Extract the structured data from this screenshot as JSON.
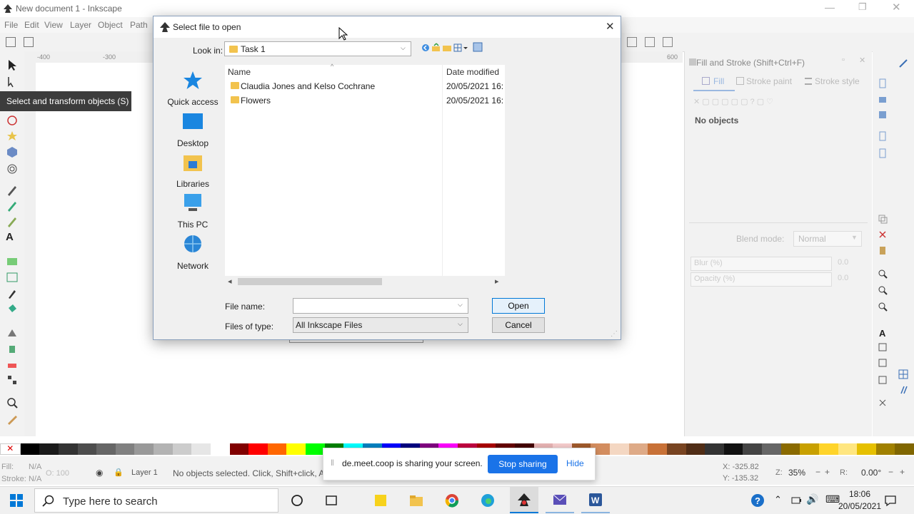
{
  "app": {
    "window_title": "New document 1 - Inkscape",
    "menus": [
      "File",
      "Edit",
      "View",
      "Layer",
      "Object",
      "Path"
    ],
    "tooltip": "Select and transform objects (S)",
    "ruler_marks": [
      "-400",
      "-300",
      "600"
    ]
  },
  "fill_stroke_panel": {
    "title": "Fill and Stroke (Shift+Ctrl+F)",
    "tabs": [
      "Fill",
      "Stroke paint",
      "Stroke style"
    ],
    "no_objects": "No objects",
    "blend_mode_label": "Blend mode:",
    "blend_mode_value": "Normal",
    "blur_label": "Blur (%)",
    "blur_value": "0.0",
    "opacity_label": "Opacity (%)",
    "opacity_value": "0.0"
  },
  "dialog": {
    "title": "Select file to open",
    "look_in_label": "Look in:",
    "look_in_value": "Task 1",
    "nav_items": [
      {
        "label": "Quick access",
        "icon": "star-icon"
      },
      {
        "label": "Desktop",
        "icon": "desktop-icon"
      },
      {
        "label": "Libraries",
        "icon": "libraries-icon"
      },
      {
        "label": "This PC",
        "icon": "computer-icon"
      },
      {
        "label": "Network",
        "icon": "network-icon"
      }
    ],
    "columns": {
      "name": "Name",
      "date": "Date modified"
    },
    "files": [
      {
        "name": "Claudia Jones and Kelso Cochrane",
        "date": "20/05/2021 16:"
      },
      {
        "name": "Flowers",
        "date": "20/05/2021 16:"
      }
    ],
    "file_name_label": "File name:",
    "file_name_value": "",
    "files_of_type_label": "Files of type:",
    "files_of_type_value": "All Inkscape Files",
    "open_label": "Open",
    "cancel_label": "Cancel"
  },
  "status": {
    "fill_label": "Fill:",
    "fill_value": "N/A",
    "stroke_label": "Stroke:",
    "stroke_value": "N/A",
    "opacity": "O: 100",
    "layer": "Layer 1",
    "message": "No objects selected. Click, Shift+click, A",
    "x_coord": "X: -325.82",
    "y_coord": "Y: -135.32",
    "zoom_label": "Z:",
    "zoom_value": "35%",
    "rotation_label": "R:",
    "rotation_value": "0.00°"
  },
  "sharing": {
    "message": "de.meet.coop is sharing your screen.",
    "stop_label": "Stop sharing",
    "hide_label": "Hide"
  },
  "taskbar": {
    "search_placeholder": "Type here to search",
    "time": "18:06",
    "date": "20/05/2021"
  },
  "colors": {
    "accent": "#0078d7",
    "folder": "#f2c34e"
  }
}
